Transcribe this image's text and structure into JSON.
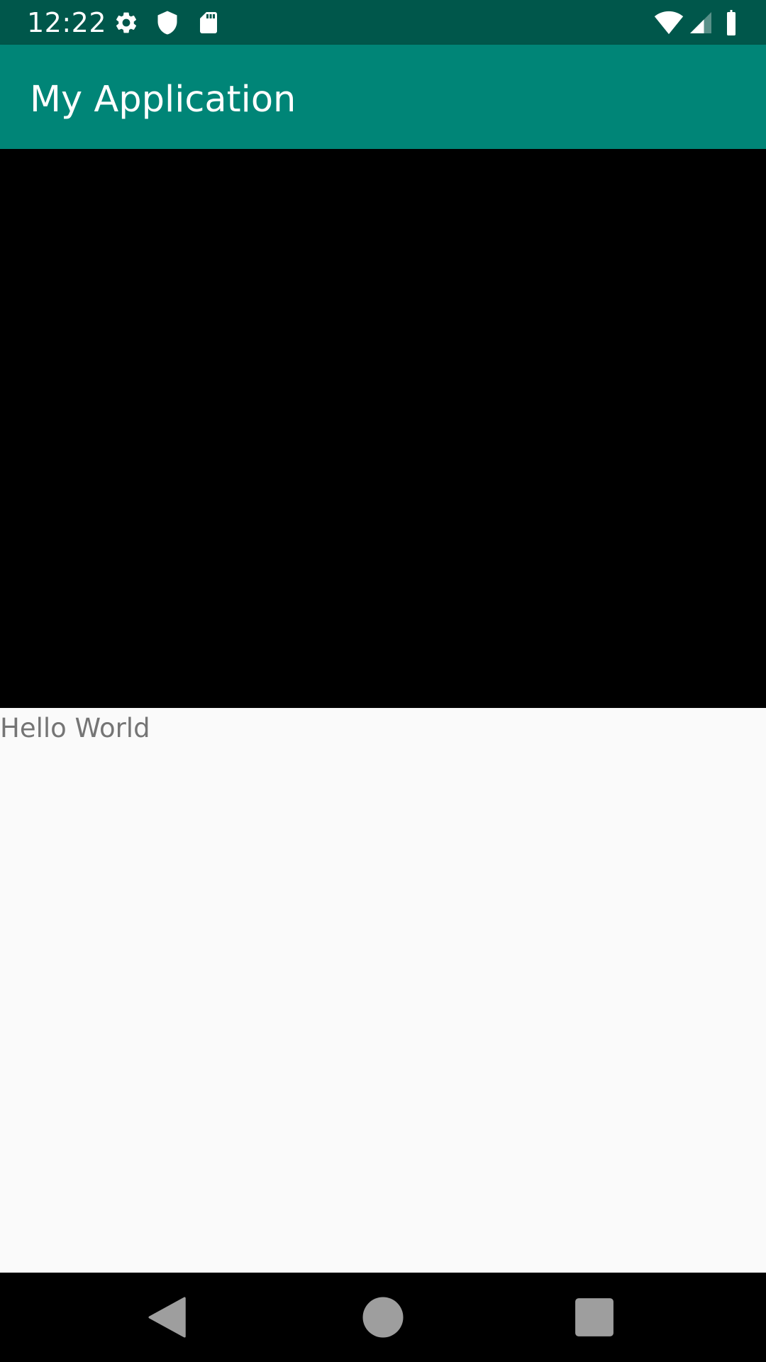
{
  "status_bar": {
    "time": "12:22",
    "icons_left": [
      "gear-icon",
      "shield-icon",
      "sd-card-icon"
    ],
    "icons_right": [
      "wifi-icon",
      "cell-signal-icon",
      "battery-icon"
    ],
    "background_color": "#00574b"
  },
  "app_bar": {
    "title": "My Application",
    "background_color": "#008577"
  },
  "content": {
    "video_background": "#000000",
    "text": "Hello World"
  },
  "nav_bar": {
    "buttons": [
      "back-icon",
      "home-icon",
      "recents-icon"
    ]
  }
}
